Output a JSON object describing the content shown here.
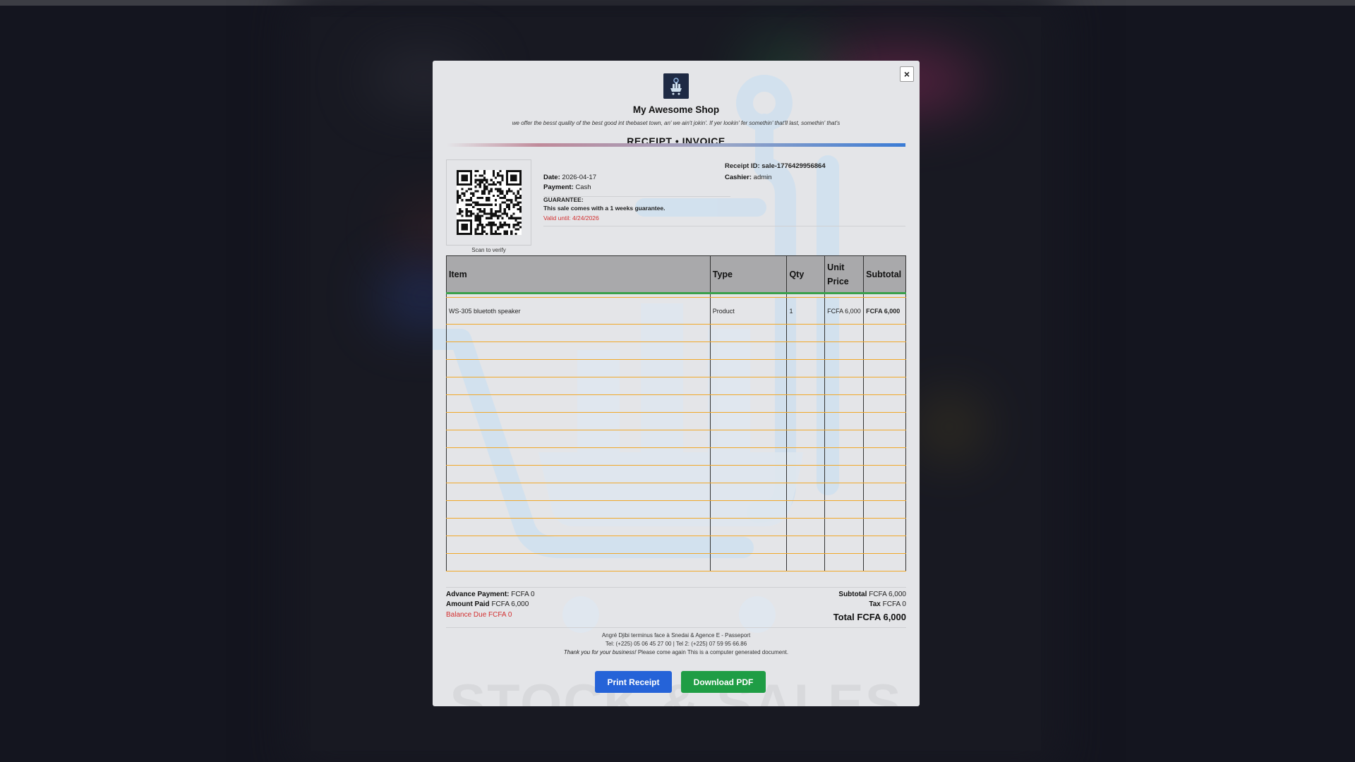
{
  "shop": {
    "name": "My Awesome Shop",
    "tagline": "we offer the besst quality of the best good int thebaset town, an' we ain't jokin'. If yer lookin' fer somethin' that'll last, somethin' that's",
    "close_label": "×"
  },
  "receipt": {
    "title": "RECEIPT • INVOICE",
    "scan_label": "Scan to verify",
    "date_label": "Date:",
    "date": "2026-04-17",
    "payment_label": "Payment:",
    "payment": "Cash",
    "guarantee_label": "GUARANTEE:",
    "guarantee_text": "This sale comes with a 1 weeks guarantee.",
    "valid_until": "Valid until: 4/24/2026",
    "receipt_id_label": "Receipt ID:",
    "receipt_id": "sale-1776429956864",
    "cashier_label": "Cashier:",
    "cashier": "admin"
  },
  "table": {
    "headers": [
      "Item",
      "Type",
      "Qty",
      "Unit Price",
      "Subtotal"
    ],
    "rows": [
      {
        "item": "WS-305 bluetoth speaker",
        "type": "Product",
        "qty": "1",
        "unit_price": "FCFA 6,000",
        "subtotal": "FCFA 6,000"
      }
    ],
    "empty_rows": 14
  },
  "totals": {
    "advance_label": "Advance Payment:",
    "advance": "FCFA 0",
    "paid_label": "Amount Paid",
    "paid": "FCFA 6,000",
    "balance": "Balance Due FCFA 0",
    "subtotal_label": "Subtotal",
    "subtotal": "FCFA 6,000",
    "tax_label": "Tax",
    "tax": "FCFA 0",
    "total": "Total FCFA 6,000"
  },
  "footer": {
    "address": "Angré Djibi terminus face à Snedai & Agence E - Passeport",
    "phones": "Tel: (+225) 05 06 45 27 00 | Tel 2: (+225) 07 59 95 66.86",
    "thanks": "Thank you for your business!",
    "note": "Please come again This is a computer generated document."
  },
  "actions": {
    "print": "Print Receipt",
    "download": "Download PDF"
  },
  "watermark": {
    "text": "STOCK & SALES",
    "icon": "cart-chart-icon"
  },
  "colors": {
    "print_button": "#2563d8",
    "pdf_button": "#1f9d45",
    "balance_due": "#d32f2f",
    "row_lines": "#f0a82a",
    "header_underline": "#3aa04a"
  }
}
